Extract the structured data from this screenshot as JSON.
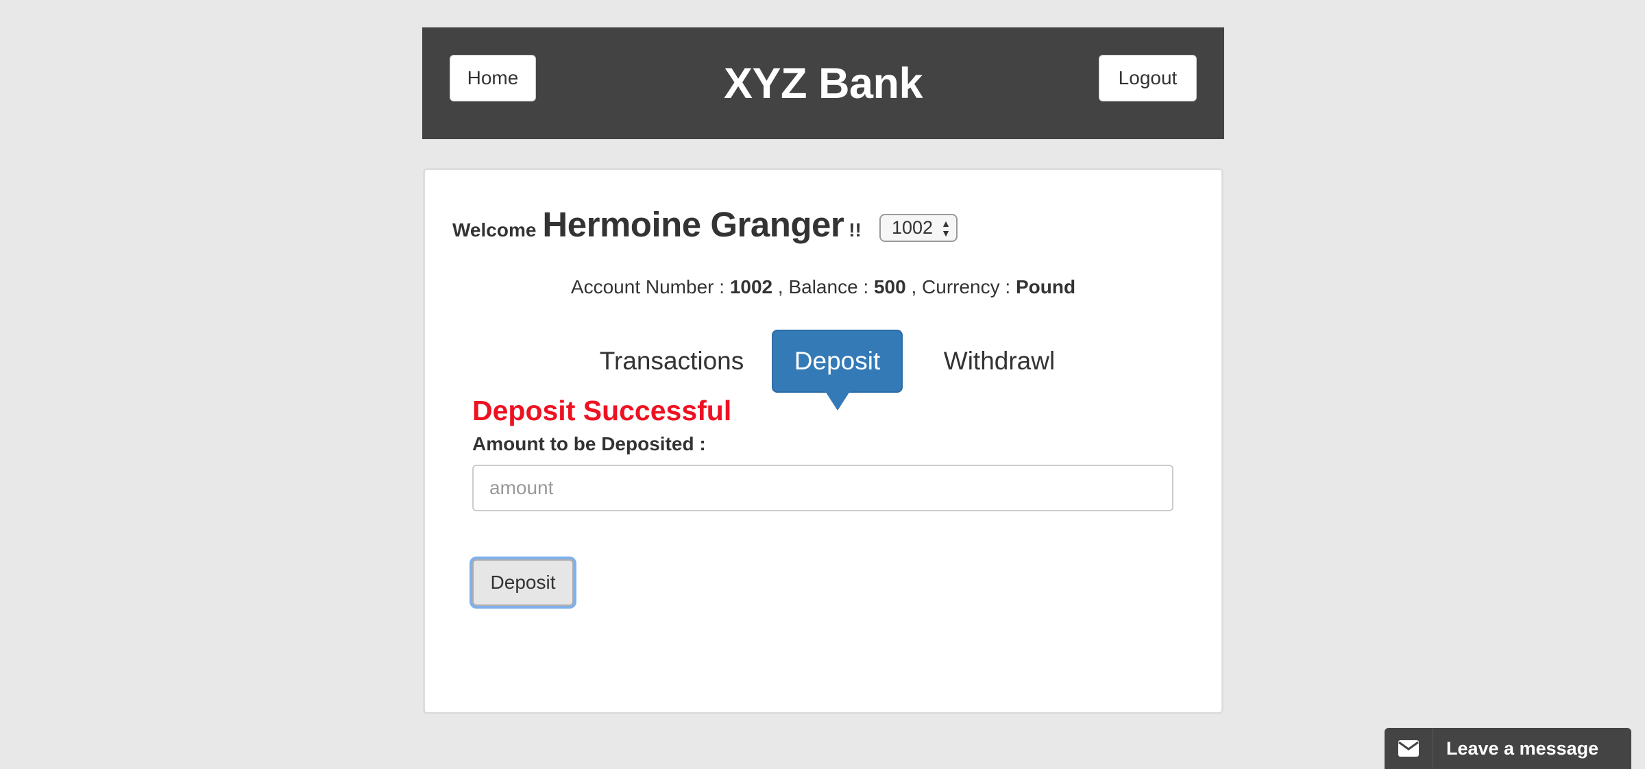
{
  "header": {
    "home_label": "Home",
    "title": "XYZ Bank",
    "logout_label": "Logout"
  },
  "customer": {
    "welcome_text": "Welcome",
    "name": "Hermoine Granger",
    "exclaim": "!!",
    "selected_account": "1002"
  },
  "account_info": {
    "number_label": "Account Number :",
    "number": "1002",
    "balance_label": ", Balance :",
    "balance": "500",
    "currency_label": ", Currency :",
    "currency": "Pound"
  },
  "tabs": [
    {
      "label": "Transactions",
      "active": false
    },
    {
      "label": "Deposit",
      "active": true
    },
    {
      "label": "Withdrawl",
      "active": false
    }
  ],
  "deposit_form": {
    "message": "Deposit Successful",
    "amount_label": "Amount to be Deposited :",
    "amount_value": "",
    "amount_placeholder": "amount",
    "submit_label": "Deposit"
  },
  "chat_widget": {
    "label": "Leave a message",
    "icon": "envelope-icon"
  },
  "colors": {
    "header_bg": "#434343",
    "page_bg": "#e8e8e8",
    "active_tab": "#337ab7",
    "success_text": "#ee1122"
  }
}
